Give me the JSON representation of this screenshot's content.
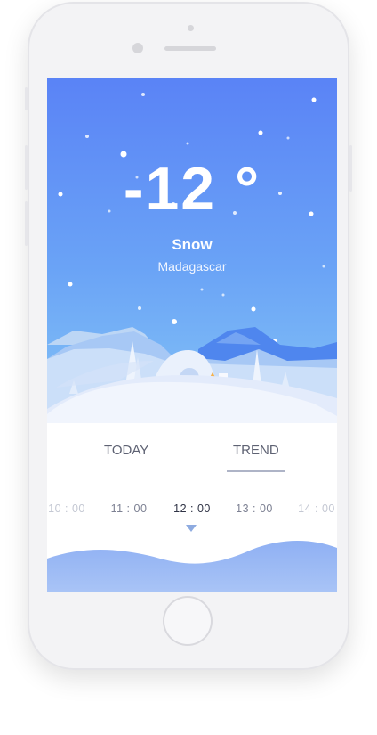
{
  "weather": {
    "temperature": "-12 °",
    "condition": "Snow",
    "location": "Madagascar"
  },
  "tabs": [
    "TODAY",
    "TREND"
  ],
  "active_tab": "TREND",
  "times": [
    "10 : 00",
    "11 : 00",
    "12 : 00",
    "13 : 00",
    "14 : 00"
  ],
  "selected_time": "12 : 00",
  "colors": {
    "sky_top": "#5a83f6",
    "sky_bottom": "#84c4f7",
    "accent": "#8eabe0"
  }
}
